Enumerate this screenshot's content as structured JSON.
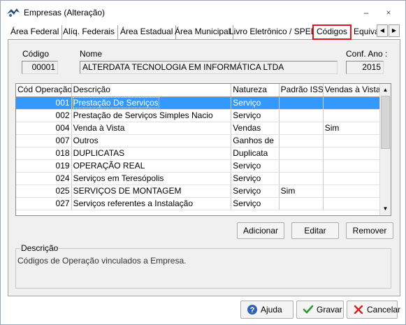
{
  "window": {
    "title": "Empresas (Alteração)",
    "minimize": "–",
    "close": "×"
  },
  "tabs": [
    {
      "label": "Área Federal"
    },
    {
      "label": "Alíq. Federais"
    },
    {
      "label": "Área Estadual"
    },
    {
      "label": "Área Municipal"
    },
    {
      "label": "Livro Eletrônico / SPED"
    },
    {
      "label": "Códigos",
      "active": true
    },
    {
      "label": "Equival"
    }
  ],
  "header": {
    "codigo_label": "Código",
    "codigo_value": "00001",
    "nome_label": "Nome",
    "nome_value": "ALTERDATA TECNOLOGIA EM INFORMÁTICA LTDA",
    "conf_ano_label": "Conf. Ano :",
    "conf_ano_value": "2015"
  },
  "grid": {
    "columns": [
      "Cód Operação",
      "Descrição",
      "Natureza",
      "Padrão ISS",
      "Vendas à Vista"
    ],
    "rows": [
      {
        "cod": "001",
        "descricao": "Prestação De Serviços",
        "natureza": "Serviço",
        "padrao_iss": "",
        "vendas_vista": "",
        "selected": true
      },
      {
        "cod": "002",
        "descricao": "Prestação de Serviços Simples Nacio",
        "natureza": "Serviço",
        "padrao_iss": "",
        "vendas_vista": ""
      },
      {
        "cod": "004",
        "descricao": "Venda à Vista",
        "natureza": "Vendas",
        "padrao_iss": "",
        "vendas_vista": "Sim"
      },
      {
        "cod": "007",
        "descricao": "Outros",
        "natureza": "Ganhos de",
        "padrao_iss": "",
        "vendas_vista": ""
      },
      {
        "cod": "018",
        "descricao": "DUPLICATAS",
        "natureza": "Duplicata",
        "padrao_iss": "",
        "vendas_vista": ""
      },
      {
        "cod": "019",
        "descricao": "OPERAÇÃO REAL",
        "natureza": "Serviço",
        "padrao_iss": "",
        "vendas_vista": ""
      },
      {
        "cod": "024",
        "descricao": "Serviços em Teresópolis",
        "natureza": "Serviço",
        "padrao_iss": "",
        "vendas_vista": ""
      },
      {
        "cod": "025",
        "descricao": "SERVIÇOS DE MONTAGEM",
        "natureza": "Serviço",
        "padrao_iss": "Sim",
        "vendas_vista": ""
      },
      {
        "cod": "027",
        "descricao": "Serviços referentes a Instalação",
        "natureza": "Serviço",
        "padrao_iss": "",
        "vendas_vista": ""
      }
    ]
  },
  "actions": {
    "adicionar": "Adicionar",
    "editar": "Editar",
    "remover": "Remover"
  },
  "descricao_box": {
    "title": "Descrição",
    "text": "Códigos de Operação vinculados a Empresa."
  },
  "footer": {
    "ajuda": "Ajuda",
    "gravar": "Gravar",
    "cancelar": "Cancelar"
  },
  "colors": {
    "selection": "#3399ff",
    "highlight_border": "#e3141d",
    "panel_bg": "#f0f0f0"
  }
}
